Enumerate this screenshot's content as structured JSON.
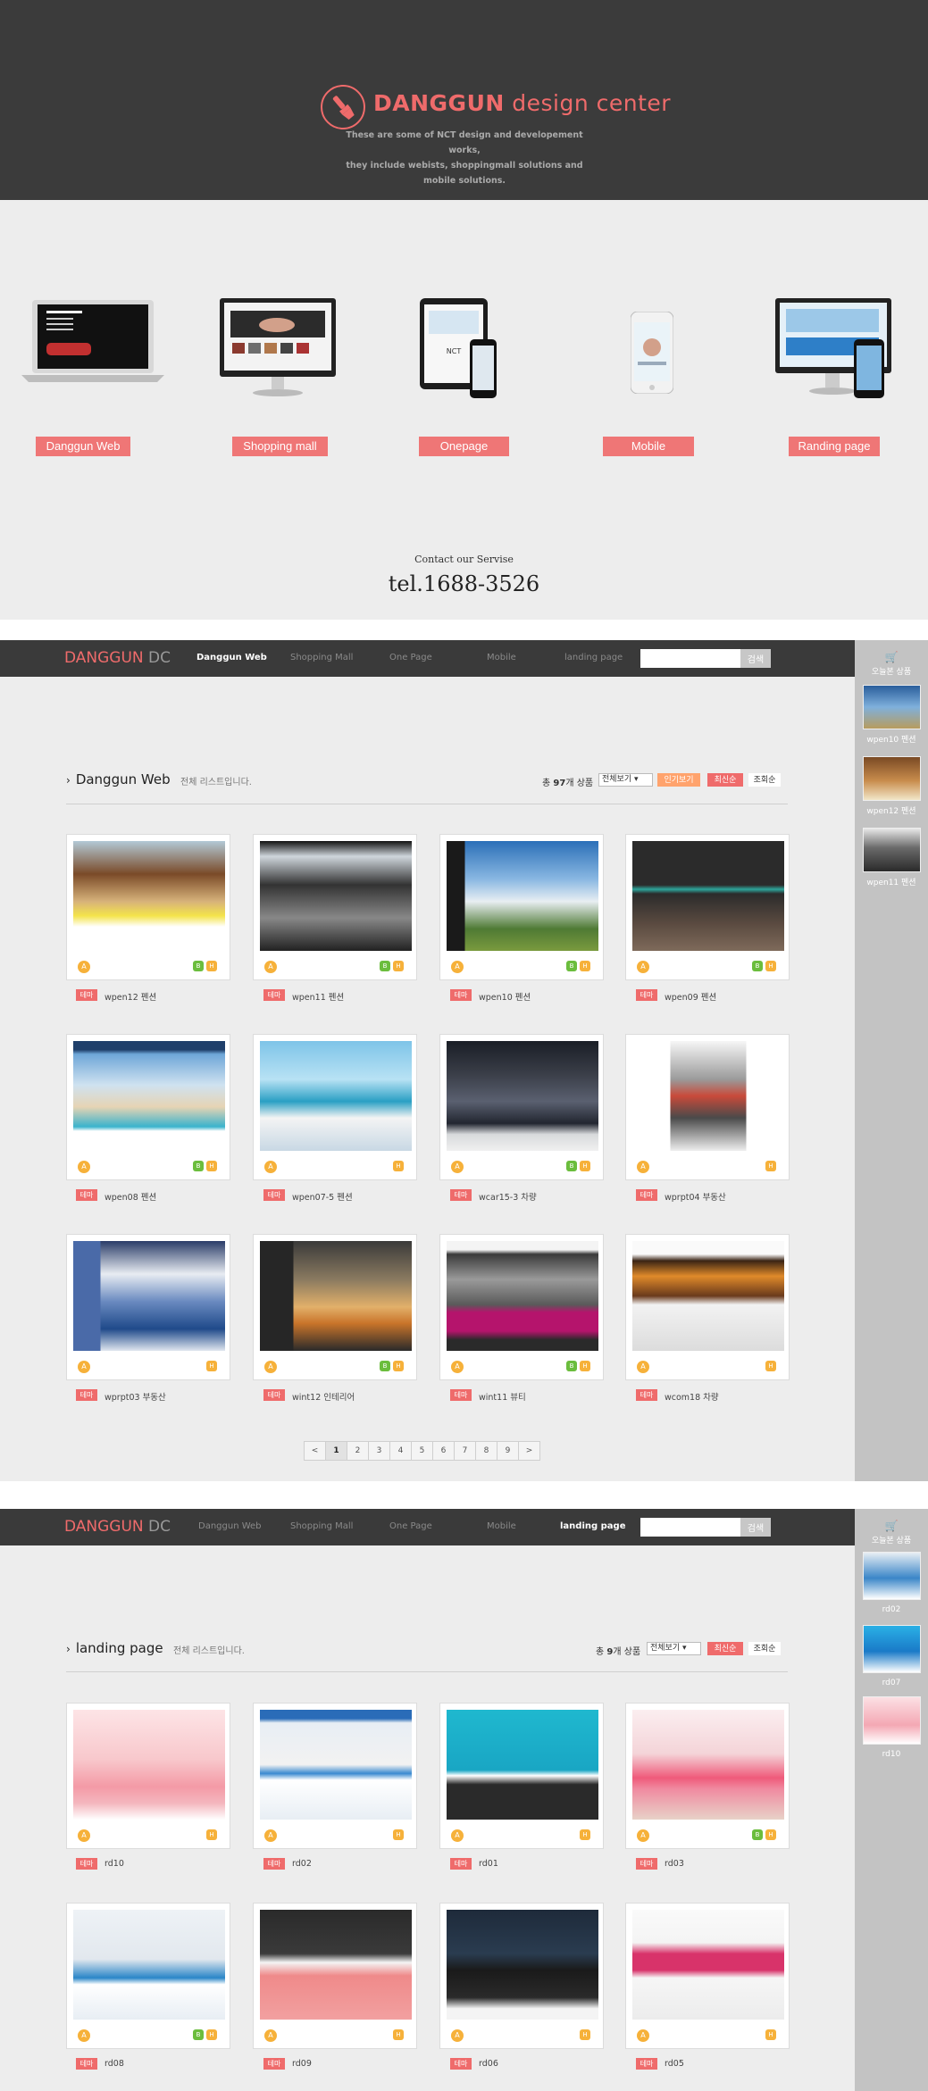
{
  "hero": {
    "brand_bold": "DANGGUN",
    "brand_rest": " design center",
    "subtitle_line1": "These are some of NCT design and developement works,",
    "subtitle_line2": "they include webists, shoppingmall solutions and mobile solutions."
  },
  "services": {
    "items": [
      {
        "label": "Danggun Web"
      },
      {
        "label": "Shopping mall"
      },
      {
        "label": "Onepage"
      },
      {
        "label": "Mobile"
      },
      {
        "label": "Randing page"
      }
    ],
    "contact_label": "Contact our Servise",
    "tel": "tel.1688-3526"
  },
  "nav": {
    "logo_main": "DANGGUN",
    "logo_sub": " DC",
    "items": [
      "Danggun Web",
      "Shopping Mall",
      "One Page",
      "Mobile",
      "landing page"
    ],
    "search_placeholder": "",
    "search_button": "검색"
  },
  "sidebar": {
    "title": "오늘본 상품",
    "cart_icon": "cart-icon"
  },
  "section1": {
    "title": "Danggun Web",
    "subtitle": "전체 리스트입니다.",
    "count_prefix": "총 ",
    "count": "97",
    "count_suffix": "개 상품",
    "select": "전체보기 ▾",
    "sort": [
      "인기보기",
      "최신순",
      "조회순"
    ],
    "recent": [
      "wpen10 펜션",
      "wpen12 펜션",
      "wpen11 펜션"
    ],
    "tag": "테마",
    "cards": [
      {
        "name": "wpen12 펜션"
      },
      {
        "name": "wpen11 펜션"
      },
      {
        "name": "wpen10 펜션"
      },
      {
        "name": "wpen09 펜션"
      },
      {
        "name": "wpen08 펜션"
      },
      {
        "name": "wpen07-5 펜션"
      },
      {
        "name": "wcar15-3 차량"
      },
      {
        "name": "wprpt04 부동산"
      },
      {
        "name": "wprpt03 부동산"
      },
      {
        "name": "wint12 인테리어"
      },
      {
        "name": "wint11 뷰티"
      },
      {
        "name": "wcom18 차량"
      }
    ],
    "pages": [
      "<",
      "1",
      "2",
      "3",
      "4",
      "5",
      "6",
      "7",
      "8",
      "9",
      ">"
    ],
    "badge_a": "A",
    "badge_h": "H",
    "badge_g": "B"
  },
  "section2": {
    "title": "landing page",
    "subtitle": "전체 리스트입니다.",
    "count_prefix": "총 ",
    "count": "9",
    "count_suffix": "개 상품",
    "select": "전체보기 ▾",
    "sort": [
      "최신순",
      "조회순"
    ],
    "recent": [
      "rd02",
      "rd07",
      "rd10"
    ],
    "tag": "테마",
    "cards": [
      {
        "name": "rd10"
      },
      {
        "name": "rd02"
      },
      {
        "name": "rd01"
      },
      {
        "name": "rd03"
      },
      {
        "name": "rd08"
      },
      {
        "name": "rd09"
      },
      {
        "name": "rd06"
      },
      {
        "name": "rd05"
      }
    ]
  },
  "colors": {
    "accent": "#ef6b6b",
    "dark": "#3a3a3a",
    "panel": "#ededed"
  }
}
